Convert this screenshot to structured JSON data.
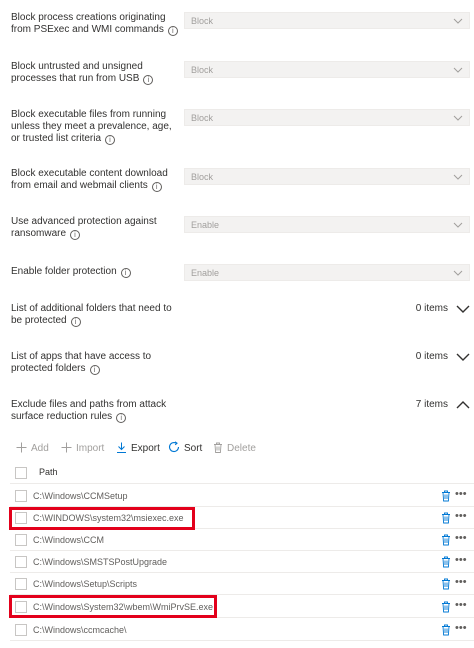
{
  "settings": [
    {
      "label": "Block process creations originating from PSExec and WMI commands",
      "value": "Block"
    },
    {
      "label": "Block untrusted and unsigned processes that run from USB",
      "value": "Block"
    },
    {
      "label": "Block executable files from running unless they meet a prevalence, age, or trusted list criteria",
      "value": "Block"
    },
    {
      "label": "Block executable content download from email and webmail clients",
      "value": "Block"
    },
    {
      "label": "Use advanced protection against ransomware",
      "value": "Enable"
    },
    {
      "label": "Enable folder protection",
      "value": "Enable"
    }
  ],
  "lists": [
    {
      "label": "List of additional folders that need to be protected",
      "count": "0 items",
      "expanded": false
    },
    {
      "label": "List of apps that have access to protected folders",
      "count": "0 items",
      "expanded": false
    },
    {
      "label": "Exclude files and paths from attack surface reduction rules",
      "count": "7 items",
      "expanded": true
    }
  ],
  "toolbar": {
    "add": "Add",
    "import": "Import",
    "export": "Export",
    "sort": "Sort",
    "delete": "Delete"
  },
  "table": {
    "header": "Path",
    "rows": [
      {
        "path": "C:\\Windows\\CCMSetup",
        "highlighted": false
      },
      {
        "path": "C:\\WINDOWS\\system32\\msiexec.exe",
        "highlighted": true
      },
      {
        "path": "C:\\Windows\\CCM",
        "highlighted": false
      },
      {
        "path": "C:\\Windows\\SMSTSPostUpgrade",
        "highlighted": false
      },
      {
        "path": "C:\\Windows\\Setup\\Scripts",
        "highlighted": false
      },
      {
        "path": "C:\\Windows\\System32\\wbem\\WmiPrvSE.exe",
        "highlighted": true
      },
      {
        "path": "C:\\Windows\\ccmcache\\",
        "highlighted": false
      }
    ]
  },
  "colors": {
    "accent": "#0078d4",
    "highlight": "#e3001b"
  }
}
